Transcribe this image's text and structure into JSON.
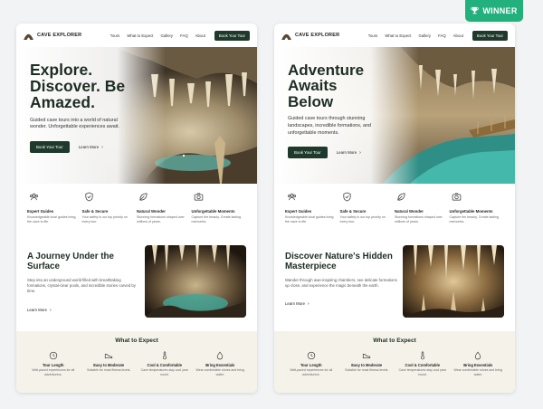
{
  "badge": {
    "label": "WINNER",
    "icon": "trophy-icon"
  },
  "colors": {
    "brand_green": "#1f3a2c",
    "winner_green": "#22b07d",
    "cream": "#f5f2ea"
  },
  "variants": [
    {
      "nav": {
        "brand": "CAVE EXPLORER",
        "links": [
          "Tours",
          "What to Expect",
          "Gallery",
          "FAQ",
          "About"
        ],
        "cta": "Book Your Tour"
      },
      "hero": {
        "title": "Explore. Discover. Be Amazed.",
        "subtitle": "Guided cave tours into a world of natural wonder. Unforgettable experiences await.",
        "primary": "Book Your Tour",
        "secondary": "Learn More"
      },
      "features": [
        {
          "title": "Expert Guides",
          "desc": "Knowledgeable local guides bring the cave to life.",
          "icon": "people-icon"
        },
        {
          "title": "Safe & Secure",
          "desc": "Your safety is our top priority on every tour.",
          "icon": "shield-icon"
        },
        {
          "title": "Natural Wonder",
          "desc": "Stunning formations shaped over millions of years.",
          "icon": "leaf-icon"
        },
        {
          "title": "Unforgettable Moments",
          "desc": "Capture the beauty. Create lasting memories.",
          "icon": "camera-icon"
        }
      ],
      "story": {
        "title": "A Journey Under the Surface",
        "subtitle": "Step into an underground world filled with breathtaking formations, crystal-clear pools, and incredible stories carved by time.",
        "link": "Learn More"
      },
      "expect": {
        "title": "What to Expect",
        "items": [
          {
            "title": "Tour Length",
            "desc": "Well-paced experiences for all adventurers.",
            "icon": "clock-icon"
          },
          {
            "title": "Easy to Moderate",
            "desc": "Suitable for most fitness levels.",
            "icon": "shoe-icon"
          },
          {
            "title": "Cool & Comfortable",
            "desc": "Cave temperatures stay cool year round.",
            "icon": "thermometer-icon"
          },
          {
            "title": "Bring Essentials",
            "desc": "Wear comfortable shoes and bring water.",
            "icon": "water-drop-icon"
          }
        ]
      }
    },
    {
      "nav": {
        "brand": "CAVE EXPLORER",
        "links": [
          "Tours",
          "What to Expect",
          "Gallery",
          "FAQ",
          "About"
        ],
        "cta": "Book Your Tour"
      },
      "hero": {
        "title": "Adventure Awaits Below",
        "subtitle": "Guided cave tours through stunning landscapes, incredible formations, and unforgettable moments.",
        "primary": "Book Your Tour",
        "secondary": "Learn More"
      },
      "features": [
        {
          "title": "Expert Guides",
          "desc": "Knowledgeable local guides bring the cave to life.",
          "icon": "people-icon"
        },
        {
          "title": "Safe & Secure",
          "desc": "Your safety is our top priority on every tour.",
          "icon": "shield-icon"
        },
        {
          "title": "Natural Wonder",
          "desc": "Stunning formations shaped over millions of years.",
          "icon": "leaf-icon"
        },
        {
          "title": "Unforgettable Moments",
          "desc": "Capture the beauty. Create lasting memories.",
          "icon": "camera-icon"
        }
      ],
      "story": {
        "title": "Discover Nature's Hidden Masterpiece",
        "subtitle": "Wander through awe-inspiring chambers, see delicate formations up close, and experience the magic beneath the earth.",
        "link": "Learn More"
      },
      "expect": {
        "title": "What to Expect",
        "items": [
          {
            "title": "Tour Length",
            "desc": "Well-paced experiences for all adventurers.",
            "icon": "clock-icon"
          },
          {
            "title": "Easy to Moderate",
            "desc": "Suitable for most fitness levels.",
            "icon": "shoe-icon"
          },
          {
            "title": "Cool & Comfortable",
            "desc": "Cave temperatures stay cool year round.",
            "icon": "thermometer-icon"
          },
          {
            "title": "Bring Essentials",
            "desc": "Wear comfortable shoes and bring water.",
            "icon": "water-drop-icon"
          }
        ]
      }
    }
  ]
}
